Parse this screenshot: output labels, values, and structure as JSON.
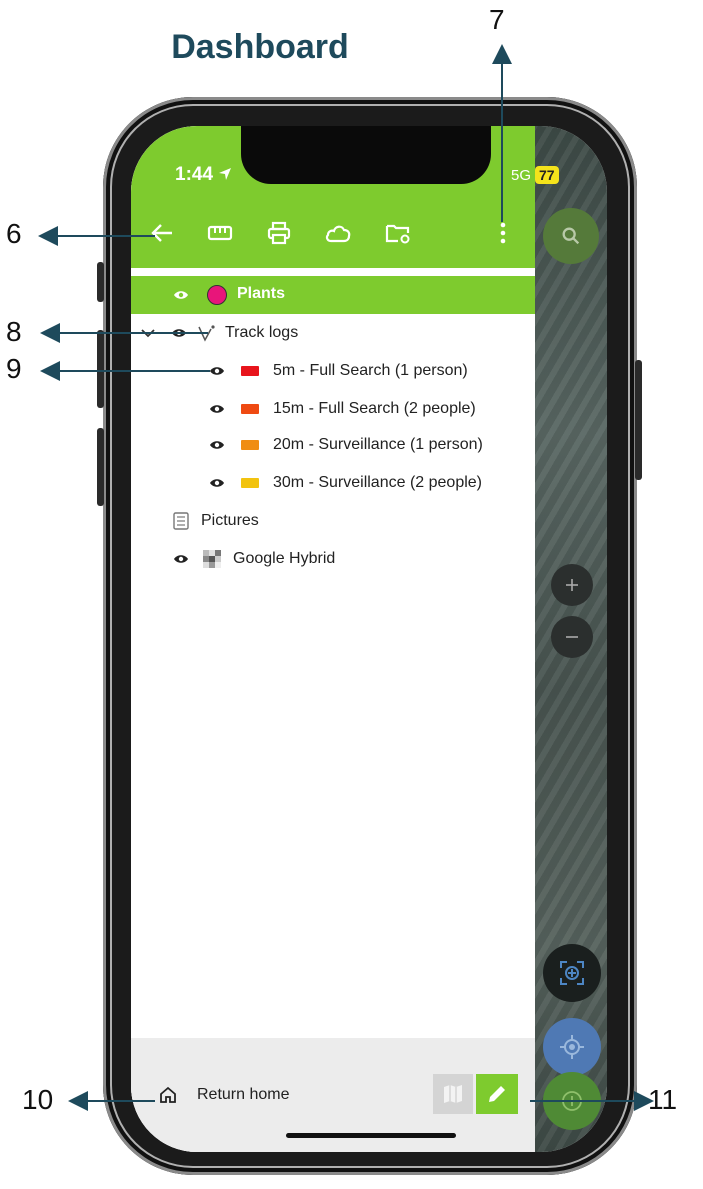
{
  "page": {
    "title": "Dashboard"
  },
  "callouts": {
    "c6": "6",
    "c7": "7",
    "c8": "8",
    "c9": "9",
    "c10": "10",
    "c11": "11"
  },
  "status_bar": {
    "time": "1:44",
    "network": "5G",
    "battery": "77"
  },
  "toolbar": {
    "icons": [
      "back-arrow-icon",
      "ruler-icon",
      "print-icon",
      "cloud-icon",
      "folder-settings-icon",
      "more-vert-icon"
    ]
  },
  "layers": {
    "selected": {
      "name": "Plants",
      "color": "#e8157a"
    },
    "track_group": {
      "name": "Track logs"
    },
    "tracks": [
      {
        "name": "5m - Full Search (1 person)",
        "color": "#e8141c"
      },
      {
        "name": "15m - Full Search (2 people)",
        "color": "#ef4a12"
      },
      {
        "name": "20m - Surveillance (1 person)",
        "color": "#f08d12"
      },
      {
        "name": "30m - Surveillance (2 people)",
        "color": "#f2c30f"
      }
    ],
    "pictures": {
      "name": "Pictures"
    },
    "basemap": {
      "name": "Google Hybrid"
    }
  },
  "bottom": {
    "home_label": "Return home"
  },
  "map_controls": [
    "search-icon",
    "zoom-in-icon",
    "zoom-out-icon",
    "center-location-icon",
    "gps-icon",
    "add-icon"
  ],
  "colors": {
    "accent": "#7ecb2e",
    "title": "#1e4a5c"
  }
}
